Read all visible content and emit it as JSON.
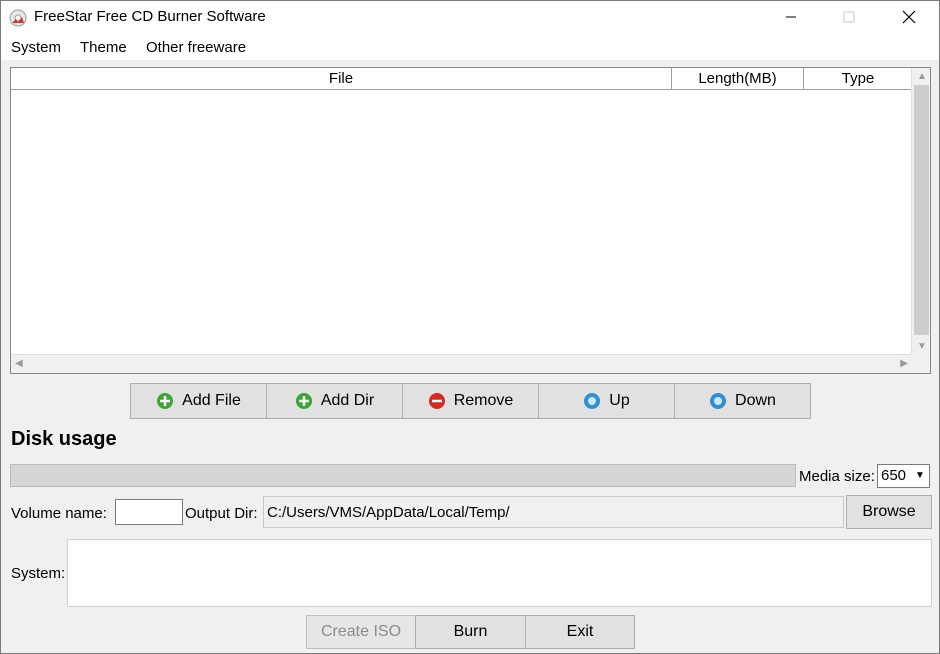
{
  "window": {
    "title": "FreeStar Free CD Burner Software"
  },
  "menu": [
    "System",
    "Theme",
    "Other freeware"
  ],
  "table": {
    "columns": [
      "File",
      "Length(MB)",
      "Type"
    ],
    "rows": []
  },
  "actions": {
    "add_file": "Add File",
    "add_dir": "Add Dir",
    "remove": "Remove",
    "up": "Up",
    "down": "Down"
  },
  "disk": {
    "heading": "Disk usage",
    "usage_fraction": 0,
    "media_size_label": "Media size:",
    "media_size_value": "650"
  },
  "volume": {
    "label": "Volume name:",
    "value": ""
  },
  "output": {
    "label": "Output Dir:",
    "value": "C:/Users/VMS/AppData/Local/Temp/",
    "browse": "Browse"
  },
  "system": {
    "label": "System:",
    "value": ""
  },
  "footer": {
    "create_iso": "Create ISO",
    "burn": "Burn",
    "exit": "Exit"
  },
  "colors": {
    "add_icon": "#3ca534",
    "remove_icon": "#d42b1e",
    "arrow_icon": "#2f8fd8"
  }
}
